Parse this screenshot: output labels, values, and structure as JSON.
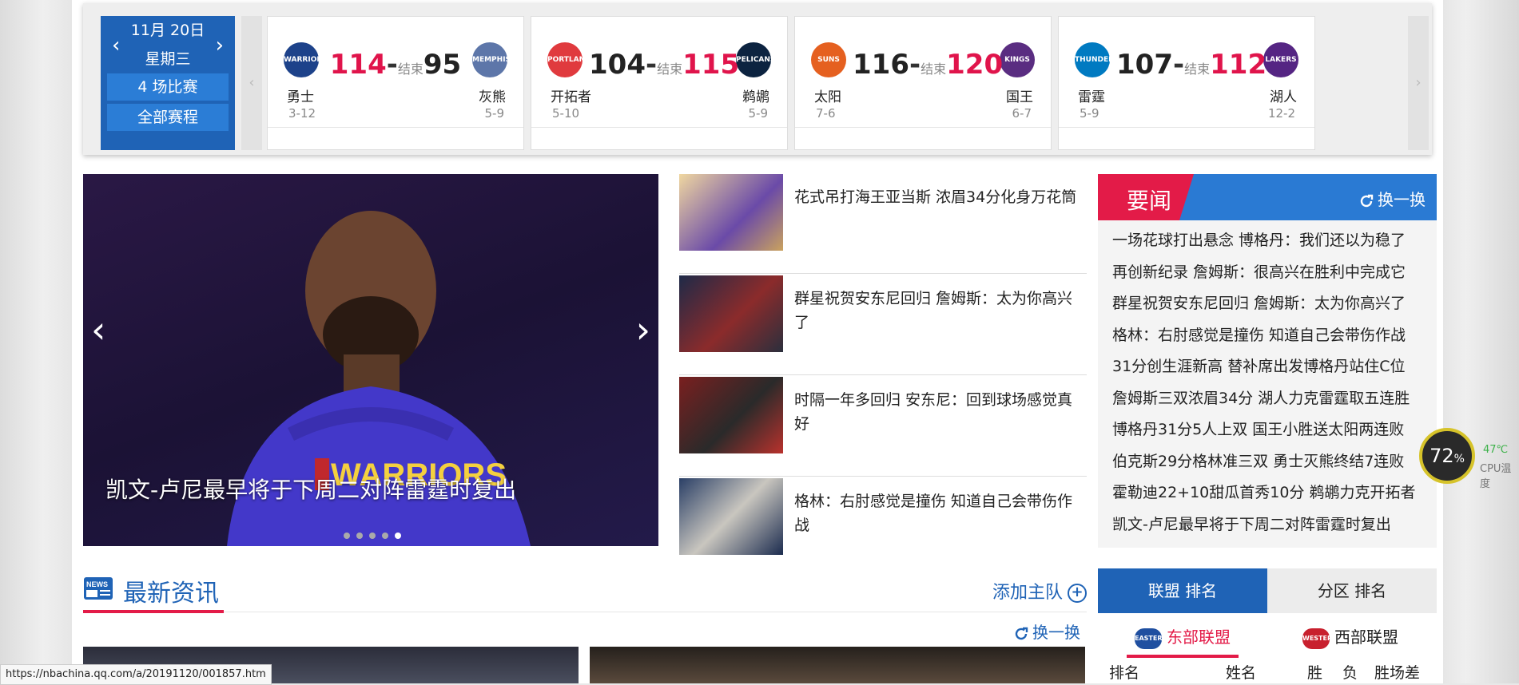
{
  "schedule": {
    "date": "11月 20日",
    "weekday": "星期三",
    "game_count": "4 场比赛",
    "all_games": "全部赛程",
    "prev_arrow": "‹",
    "next_arrow": "›",
    "games": [
      {
        "home_name": "勇士",
        "home_record": "3-12",
        "home_score": "114",
        "away_name": "灰熊",
        "away_record": "5-9",
        "away_score": "95",
        "status": "结束",
        "home_logo_text": "WARRIORS",
        "away_logo_text": "MEMPHIS",
        "home_color": "#1d428a",
        "away_color": "#5d76a9",
        "winner": "home"
      },
      {
        "home_name": "开拓者",
        "home_record": "5-10",
        "home_score": "104",
        "away_name": "鹈鹕",
        "away_record": "5-9",
        "away_score": "115",
        "status": "结束",
        "home_logo_text": "PORTLAND",
        "away_logo_text": "PELICANS",
        "home_color": "#e03a3e",
        "away_color": "#0c2340",
        "winner": "away"
      },
      {
        "home_name": "太阳",
        "home_record": "7-6",
        "home_score": "116",
        "away_name": "国王",
        "away_record": "6-7",
        "away_score": "120",
        "status": "结束",
        "home_logo_text": "SUNS",
        "away_logo_text": "KINGS",
        "home_color": "#e56020",
        "away_color": "#5a2d81",
        "winner": "away"
      },
      {
        "home_name": "雷霆",
        "home_record": "5-9",
        "home_score": "107",
        "away_name": "湖人",
        "away_record": "12-2",
        "away_score": "112",
        "status": "结束",
        "home_logo_text": "THUNDER",
        "away_logo_text": "LAKERS",
        "home_color": "#007ac1",
        "away_color": "#552583",
        "winner": "away"
      }
    ]
  },
  "slider": {
    "caption": "凯文-卢尼最早将于下周二对阵雷霆时复出",
    "jersey_text": "WARRIORS",
    "dot_count": 5,
    "active_dot": 5
  },
  "mid_news": [
    {
      "title": "花式吊打海王亚当斯 浓眉34分化身万花筒"
    },
    {
      "title": "群星祝贺安东尼回归 詹姆斯：太为你高兴了"
    },
    {
      "title": "时隔一年多回归 安东尼：回到球场感觉真好"
    },
    {
      "title": "格林：右肘感觉是撞伤 知道自己会带伤作战"
    }
  ],
  "headlines": {
    "title": "要闻",
    "swap_label": "换一换",
    "items": [
      "一场花球打出悬念 博格丹：我们还以为稳了",
      "再创新纪录 詹姆斯：很高兴在胜利中完成它",
      "群星祝贺安东尼回归 詹姆斯：太为你高兴了",
      "格林：右肘感觉是撞伤 知道自己会带伤作战",
      "31分创生涯新高 替补席出发博格丹站住C位",
      "詹姆斯三双浓眉34分 湖人力克雷霆取五连胜",
      "博格丹31分5人上双 国王小胜送太阳两连败",
      "伯克斯29分格林准三双 勇士灭熊终结7连败",
      "霍勒迪22+10甜瓜首秀10分 鹈鹕力克开拓者",
      "凯文-卢尼最早将于下周二对阵雷霆时复出"
    ]
  },
  "latest": {
    "title": "最新资讯",
    "icon_text": "NEWS",
    "add_team": "添加主队",
    "swap_label": "换一换"
  },
  "standings": {
    "tab_league": "联盟 排名",
    "tab_division": "分区 排名",
    "east": "东部联盟",
    "west": "西部联盟",
    "east_badge": "EASTERN",
    "west_badge": "WESTERN",
    "headers": {
      "rank": "排名",
      "name": "姓名",
      "win": "胜",
      "loss": "负",
      "diff": "胜场差"
    }
  },
  "status_url": "https://nbachina.qq.com/a/20191120/001857.htm",
  "cpu": {
    "percent": "72",
    "unit": "%",
    "temp": "47℃",
    "label": "CPU温度"
  },
  "colors": {
    "brand_blue": "#1f63b6",
    "accent_red": "#e31b48"
  }
}
